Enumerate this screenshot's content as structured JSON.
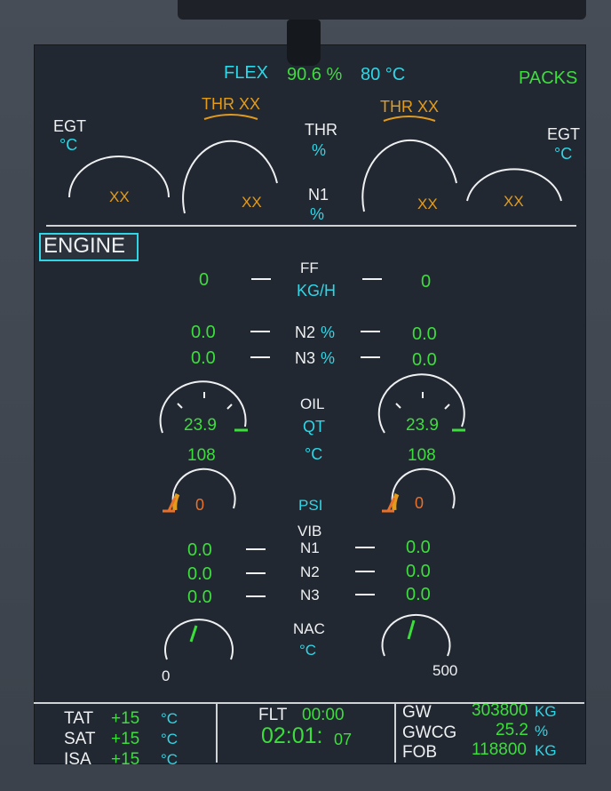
{
  "header": {
    "flex_label": "FLEX",
    "flex_value": "90.6 %",
    "flex_temp": "80 °C",
    "packs_label": "PACKS"
  },
  "egt": {
    "label": "EGT",
    "unit": "°C",
    "left_value": "XX",
    "right_value": "XX"
  },
  "n1": {
    "thr_label": "THR",
    "thr_unit": "%",
    "n1_label": "N1",
    "n1_unit": "%",
    "left_thr": "THR XX",
    "right_thr": "THR XX",
    "left_value": "XX",
    "right_value": "XX"
  },
  "page": {
    "title": "ENGINE"
  },
  "ff": {
    "label": "FF",
    "unit": "KG/H",
    "left": "0",
    "right": "0"
  },
  "n2": {
    "label": "N2",
    "unit": "%",
    "left": "0.0",
    "right": "0.0"
  },
  "n3": {
    "label": "N3",
    "unit": "%",
    "left": "0.0",
    "right": "0.0"
  },
  "oil": {
    "label": "OIL",
    "qt_unit": "QT",
    "temp_unit": "°C",
    "left_qt": "23.9",
    "right_qt": "23.9",
    "left_temp": "108",
    "right_temp": "108",
    "psi_unit": "PSI",
    "left_psi": "0",
    "right_psi": "0"
  },
  "vib": {
    "label": "VIB",
    "n1_label": "N1",
    "n2_label": "N2",
    "n3_label": "N3",
    "left_n1": "0.0",
    "right_n1": "0.0",
    "left_n2": "0.0",
    "right_n2": "0.0",
    "left_n3": "0.0",
    "right_n3": "0.0"
  },
  "nac": {
    "label": "NAC",
    "unit": "°C",
    "scale_min": "0",
    "scale_max": "500"
  },
  "footer": {
    "tat_label": "TAT",
    "tat_value": "+15",
    "tat_unit": "°C",
    "sat_label": "SAT",
    "sat_value": "+15",
    "sat_unit": "°C",
    "isa_label": "ISA",
    "isa_value": "+15",
    "isa_unit": "°C",
    "flt_label": "FLT",
    "flt_time": "00:00",
    "clock_hm": "02:01:",
    "clock_s": "07",
    "gw_label": "GW",
    "gw_value": "303800",
    "gw_unit": "KG",
    "gwcg_label": "GWCG",
    "gwcg_value": "25.2",
    "gwcg_unit": "%",
    "fob_label": "FOB",
    "fob_value": "118800",
    "fob_unit": "KG"
  },
  "colors": {
    "green": "#3cde3c",
    "cyan": "#2fd6e6",
    "amber": "#e39b1a",
    "white": "#eef0f2",
    "background": "#222831"
  }
}
